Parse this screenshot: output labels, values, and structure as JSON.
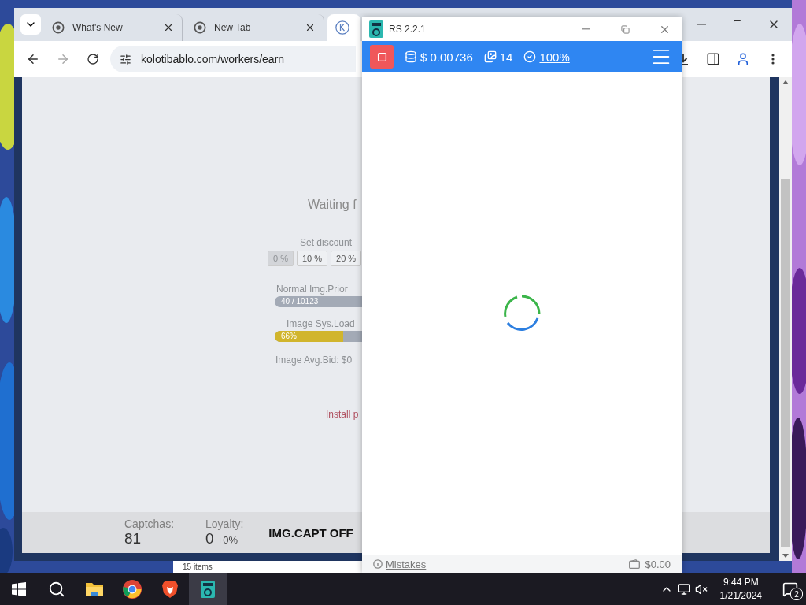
{
  "browser": {
    "tabs": [
      {
        "title": "What's New",
        "kind": "chrome",
        "selected": false
      },
      {
        "title": "New Tab",
        "kind": "chrome",
        "selected": false
      },
      {
        "kind": "site",
        "selected": true
      }
    ],
    "url": "kolotibablo.com/workers/earn",
    "page": {
      "heading": "Waiting f",
      "discount_label": "Set discount",
      "discount_options": [
        {
          "label": "0 %",
          "selected": true
        },
        {
          "label": "10 %",
          "selected": false
        },
        {
          "label": "20 %",
          "selected": false
        }
      ],
      "meters": [
        {
          "label": "Normal Img.Prior",
          "reading": "40 / 10123"
        },
        {
          "label": "Image Sys.Load",
          "reading": "66%",
          "level": 0.78
        }
      ],
      "avg_bid": "Image Avg.Bid: $0",
      "install_note": "Install p",
      "stats": [
        {
          "label": "Captchas:",
          "value": "81"
        },
        {
          "label": "Loyalty:",
          "value": "0",
          "change": "+0%"
        }
      ],
      "overlay_label": "IMG.CAPT OFF"
    }
  },
  "behind_window": {
    "status": "15 items"
  },
  "rs_window": {
    "title": "RS 2.2.1",
    "running": true,
    "balance": "$ 0.00736",
    "images": "14",
    "accuracy": "100%",
    "loading": true,
    "footer": {
      "link": "Mistakes",
      "amount": "$0.00"
    }
  },
  "taskbar": {
    "apps": [
      {
        "kind": "folder",
        "selected": false
      },
      {
        "kind": "chrome",
        "selected": false
      },
      {
        "kind": "brave",
        "selected": false
      },
      {
        "kind": "rs",
        "selected": true
      }
    ],
    "time": "9:44 PM",
    "date": "1/21/2024",
    "notifications": "2"
  }
}
